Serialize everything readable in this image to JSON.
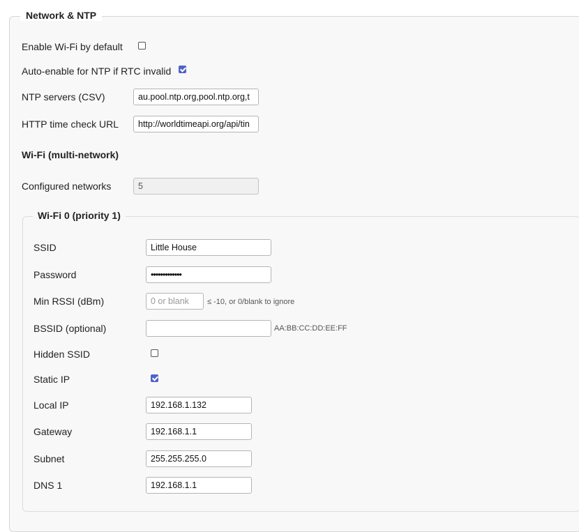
{
  "section": {
    "title": "Network & NTP"
  },
  "enable_wifi": {
    "label": "Enable Wi-Fi by default",
    "checked": false
  },
  "auto_enable_ntp": {
    "label": "Auto-enable for NTP if RTC invalid",
    "checked": true
  },
  "ntp_servers": {
    "label": "NTP servers (CSV)",
    "value": "au.pool.ntp.org,pool.ntp.org,t"
  },
  "http_time_check": {
    "label": "HTTP time check URL",
    "value": "http://worldtimeapi.org/api/tin"
  },
  "wifi_multi": {
    "heading": "Wi-Fi (multi-network)"
  },
  "configured_networks": {
    "label": "Configured networks",
    "value": "5"
  },
  "wifi0": {
    "title": "Wi-Fi 0 (priority 1)",
    "ssid": {
      "label": "SSID",
      "value": "Little House"
    },
    "password": {
      "label": "Password",
      "value": "•••••••••••••"
    },
    "min_rssi": {
      "label": "Min RSSI (dBm)",
      "placeholder": "0 or blank",
      "hint": "≤ -10, or 0/blank to ignore"
    },
    "bssid": {
      "label": "BSSID (optional)",
      "value": "",
      "hint": "AA:BB:CC:DD:EE:FF"
    },
    "hidden_ssid": {
      "label": "Hidden SSID",
      "checked": false
    },
    "static_ip": {
      "label": "Static IP",
      "checked": true
    },
    "local_ip": {
      "label": "Local IP",
      "value": "192.168.1.132"
    },
    "gateway": {
      "label": "Gateway",
      "value": "192.168.1.1"
    },
    "subnet": {
      "label": "Subnet",
      "value": "255.255.255.0"
    },
    "dns1": {
      "label": "DNS 1",
      "value": "192.168.1.1"
    }
  },
  "colors": {
    "accent": "#4f63c9",
    "panel_bg": "#f8f8f8",
    "border": "#d6d6d6"
  }
}
